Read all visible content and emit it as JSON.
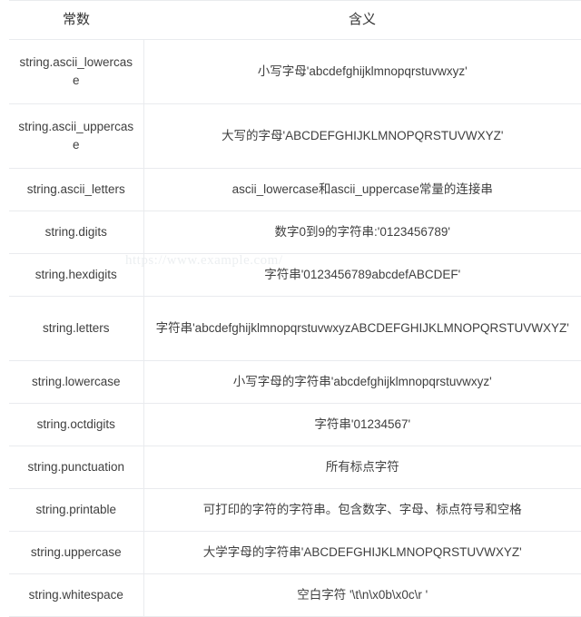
{
  "watermark": {
    "text": "https://www.example.com/"
  },
  "table": {
    "headers": [
      "常数",
      "含义"
    ],
    "rows": [
      {
        "name": "string.ascii_lowercase",
        "desc": "小写字母'abcdefghijklmnopqrstuvwxyz'",
        "tall": true
      },
      {
        "name": "string.ascii_uppercase",
        "desc": "大写的字母'ABCDEFGHIJKLMNOPQRSTUVWXYZ'",
        "tall": true
      },
      {
        "name": "string.ascii_letters",
        "desc": "ascii_lowercase和ascii_uppercase常量的连接串",
        "tall": false
      },
      {
        "name": "string.digits",
        "desc": "数字0到9的字符串:'0123456789'",
        "tall": false
      },
      {
        "name": "string.hexdigits",
        "desc": "字符串'0123456789abcdefABCDEF'",
        "tall": false
      },
      {
        "name": "string.letters",
        "desc": "字符串'abcdefghijklmnopqrstuvwxyzABCDEFGHIJKLMNOPQRSTUVWXYZ'",
        "tall": true
      },
      {
        "name": "string.lowercase",
        "desc": "小写字母的字符串'abcdefghijklmnopqrstuvwxyz'",
        "tall": false
      },
      {
        "name": "string.octdigits",
        "desc": "字符串'01234567'",
        "tall": false
      },
      {
        "name": "string.punctuation",
        "desc": "所有标点字符",
        "tall": false
      },
      {
        "name": "string.printable",
        "desc": "可打印的字符的字符串。包含数字、字母、标点符号和空格",
        "tall": false
      },
      {
        "name": "string.uppercase",
        "desc": "大学字母的字符串'ABCDEFGHIJKLMNOPQRSTUVWXYZ'",
        "tall": false
      },
      {
        "name": "string.whitespace",
        "desc": "空白字符 '\\t\\n\\x0b\\x0c\\r '",
        "tall": false
      }
    ]
  }
}
